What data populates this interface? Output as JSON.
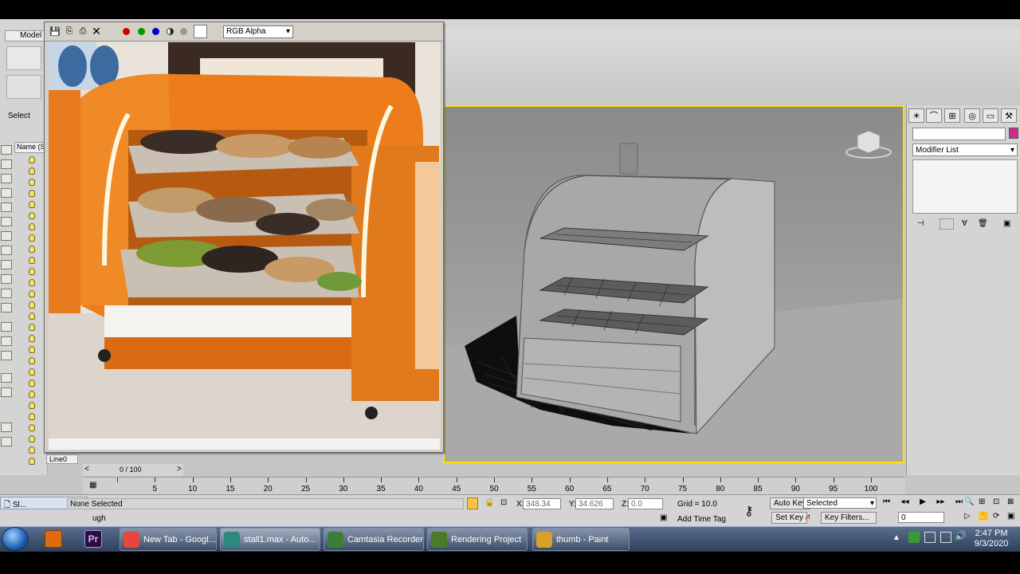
{
  "app": {
    "left_tab": "Model",
    "select_label": "Select",
    "name_column": "Name (S",
    "layer_field": "Line0"
  },
  "framebuffer": {
    "channel": "RGB Alpha",
    "dot_colors": [
      "#cc0000",
      "#009900",
      "#0000cc"
    ]
  },
  "command_panel": {
    "modifier_list": "Modifier List",
    "swatch_color": "#c8308c"
  },
  "timeline": {
    "frame_readout": "0 / 100",
    "ticks": [
      "5",
      "10",
      "15",
      "20",
      "25",
      "30",
      "35",
      "40",
      "45",
      "50",
      "55",
      "60",
      "65",
      "70",
      "75",
      "80",
      "85",
      "90",
      "95",
      "100"
    ]
  },
  "status": {
    "selection": "None Selected",
    "x_label": "X:",
    "x_value": "348.34",
    "y_label": "Y:",
    "y_value": "34.626",
    "z_label": "Z:",
    "z_value": "0.0",
    "grid": "Grid = 10.0",
    "auto_key": "Auto Key",
    "set_key": "Set Key",
    "selected_option": "Selected",
    "key_filters": "Key Filters...",
    "add_time_tag": "Add Time Tag",
    "frame_value": "0",
    "prompt_fragment": "ugh"
  },
  "mini_window": {
    "label": "Sl..."
  },
  "taskbar": {
    "items": [
      {
        "label": "New Tab - Googl...",
        "color": "#e8453c"
      },
      {
        "label": "stall1.max - Auto...",
        "color": "#2b8a7d"
      },
      {
        "label": "Camtasia Recorder",
        "color": "#3d7d3a"
      },
      {
        "label": "Rendering Project",
        "color": "#4a7a2a"
      },
      {
        "label": "thumb - Paint",
        "color": "#d9a12b"
      }
    ],
    "premiere_label": "Pr",
    "time": "2:47 PM",
    "date": "9/3/2020"
  }
}
